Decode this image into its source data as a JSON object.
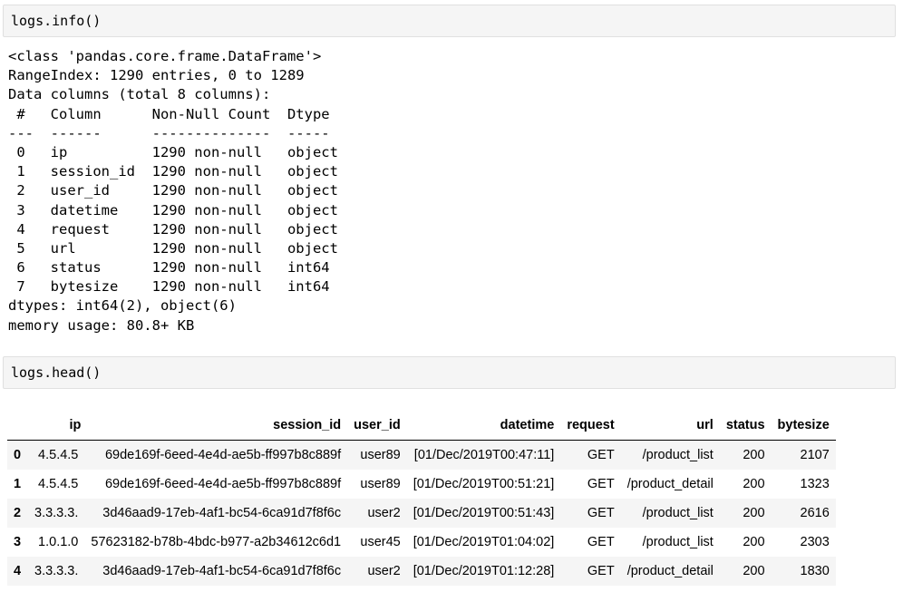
{
  "cells": [
    {
      "input": "logs.info()",
      "output_lines": [
        "<class 'pandas.core.frame.DataFrame'>",
        "RangeIndex: 1290 entries, 0 to 1289",
        "Data columns (total 8 columns):",
        " #   Column      Non-Null Count  Dtype ",
        "---  ------      --------------  ----- ",
        " 0   ip          1290 non-null   object",
        " 1   session_id  1290 non-null   object",
        " 2   user_id     1290 non-null   object",
        " 3   datetime    1290 non-null   object",
        " 4   request     1290 non-null   object",
        " 5   url         1290 non-null   object",
        " 6   status      1290 non-null   int64 ",
        " 7   bytesize    1290 non-null   int64 ",
        "dtypes: int64(2), object(6)",
        "memory usage: 80.8+ KB"
      ]
    },
    {
      "input": "logs.head()"
    }
  ],
  "dataframe": {
    "columns": [
      "ip",
      "session_id",
      "user_id",
      "datetime",
      "request",
      "url",
      "status",
      "bytesize"
    ],
    "rows": [
      {
        "index": "0",
        "ip": "4.5.4.5",
        "session_id": "69de169f-6eed-4e4d-ae5b-ff997b8c889f",
        "user_id": "user89",
        "datetime": "[01/Dec/2019T00:47:11]",
        "request": "GET",
        "url": "/product_list",
        "status": "200",
        "bytesize": "2107"
      },
      {
        "index": "1",
        "ip": "4.5.4.5",
        "session_id": "69de169f-6eed-4e4d-ae5b-ff997b8c889f",
        "user_id": "user89",
        "datetime": "[01/Dec/2019T00:51:21]",
        "request": "GET",
        "url": "/product_detail",
        "status": "200",
        "bytesize": "1323"
      },
      {
        "index": "2",
        "ip": "3.3.3.3.",
        "session_id": "3d46aad9-17eb-4af1-bc54-6ca91d7f8f6c",
        "user_id": "user2",
        "datetime": "[01/Dec/2019T00:51:43]",
        "request": "GET",
        "url": "/product_list",
        "status": "200",
        "bytesize": "2616"
      },
      {
        "index": "3",
        "ip": "1.0.1.0",
        "session_id": "57623182-b78b-4bdc-b977-a2b34612c6d1",
        "user_id": "user45",
        "datetime": "[01/Dec/2019T01:04:02]",
        "request": "GET",
        "url": "/product_list",
        "status": "200",
        "bytesize": "2303"
      },
      {
        "index": "4",
        "ip": "3.3.3.3.",
        "session_id": "3d46aad9-17eb-4af1-bc54-6ca91d7f8f6c",
        "user_id": "user2",
        "datetime": "[01/Dec/2019T01:12:28]",
        "request": "GET",
        "url": "/product_detail",
        "status": "200",
        "bytesize": "1830"
      }
    ]
  }
}
